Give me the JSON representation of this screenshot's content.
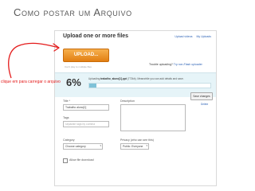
{
  "slide": {
    "title": "Como postar um Arquivo"
  },
  "panel": {
    "title": "Upload one or more files",
    "links": [
      "Upload videos",
      "My Uploads"
    ],
    "upload_button": "UPLOAD...",
    "sub_text": "Can't play to multiple files",
    "note_text": "Trouble uploading?",
    "note_link": "Try non-Flash uploader"
  },
  "progress": {
    "percent": "6%",
    "percent_value": 6,
    "status_prefix": "Uploading",
    "file_name": "trabalho_aluno[1].ppt",
    "status_suffix": "(773kb). Meanwhile you can add details and save."
  },
  "form": {
    "title_label": "Title *",
    "title_value": "Trabalho aluno[1]",
    "description_label": "Description",
    "tags_label": "Tags",
    "tags_placeholder": "separate tags by comma",
    "category_label": "Category",
    "category_value": "Choose category",
    "privacy_label": "Privacy (who can see this)",
    "privacy_value": "Public: Everyone",
    "download_label": "Allow file download",
    "save_button": "Save changes",
    "delete_link": "Delete"
  },
  "annotation": {
    "text": "clique em para carregar o arquivo"
  },
  "colors": {
    "accent": "#e27f12",
    "annotation": "#e41b1b",
    "progress_bg": "#e6f4f8"
  }
}
